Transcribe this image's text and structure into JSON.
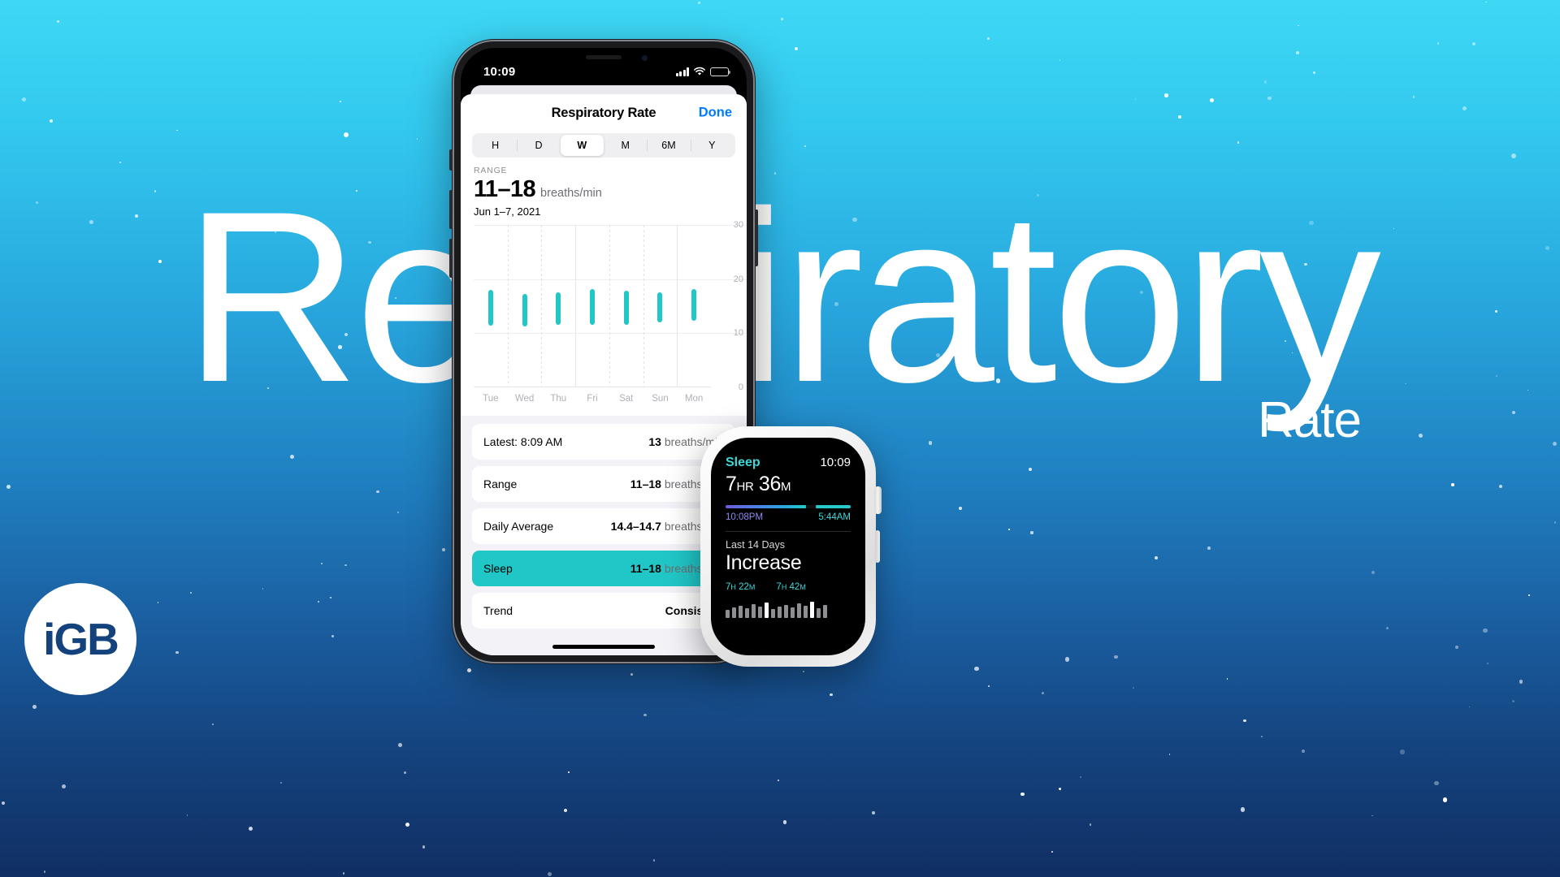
{
  "background": {
    "headline": "Respiratory",
    "subhead": "Rate",
    "accent_teal": "#21c7c7",
    "accent_blue": "#007aff",
    "gradient_top": "#3ed8f5",
    "gradient_bottom": "#102f63"
  },
  "logo": {
    "text": "iGB"
  },
  "phone": {
    "status_bar": {
      "time": "10:09",
      "signal_icon": "cellular-signal-icon",
      "wifi_icon": "wifi-icon",
      "battery_icon": "battery-icon"
    },
    "sheet": {
      "title": "Respiratory Rate",
      "done_label": "Done"
    },
    "segmented": {
      "options": [
        "H",
        "D",
        "W",
        "M",
        "6M",
        "Y"
      ],
      "selected": "W"
    },
    "summary": {
      "label": "RANGE",
      "value": "11–18",
      "unit": "breaths/min",
      "date": "Jun 1–7, 2021"
    },
    "rows": [
      {
        "label": "Latest: 8:09 AM",
        "value_num": "13",
        "value_unit": " breaths/min",
        "highlight": false
      },
      {
        "label": "Range",
        "value_num": "11–18",
        "value_unit": " breaths/min",
        "highlight": false
      },
      {
        "label": "Daily Average",
        "value_num": "14.4–14.7",
        "value_unit": " breaths/min",
        "highlight": false
      },
      {
        "label": "Sleep",
        "value_num": "11–18",
        "value_unit": " breaths/min",
        "highlight": true
      },
      {
        "label": "Trend",
        "value_num": "Consistent",
        "value_unit": "",
        "highlight": false
      }
    ]
  },
  "watch": {
    "app_label": "Sleep",
    "time": "10:09",
    "duration": "7HR 36M",
    "duration_main": "7",
    "sleep_start": "10:08PM",
    "sleep_end": "5:44AM",
    "period_label": "Last 14 Days",
    "trend": "Increase",
    "avg_left": "7H 22M",
    "avg_right": "7H 42M"
  },
  "chart_data": {
    "type": "bar",
    "title": "Respiratory Rate",
    "subtitle": "Jun 1–7, 2021",
    "xlabel": "",
    "ylabel": "breaths/min",
    "categories": [
      "Tue",
      "Wed",
      "Thu",
      "Fri",
      "Sat",
      "Sun",
      "Mon"
    ],
    "ranges": [
      {
        "low": 11.4,
        "high": 18.0
      },
      {
        "low": 11.2,
        "high": 17.2
      },
      {
        "low": 11.5,
        "high": 17.6
      },
      {
        "low": 11.6,
        "high": 18.1
      },
      {
        "low": 11.5,
        "high": 17.9
      },
      {
        "low": 12.0,
        "high": 17.5
      },
      {
        "low": 12.3,
        "high": 18.2
      }
    ],
    "yticks": [
      0,
      10,
      20,
      30
    ],
    "ylim": [
      0,
      30
    ],
    "grid": true,
    "legend": "none",
    "bar_color": "#21c7c7"
  }
}
